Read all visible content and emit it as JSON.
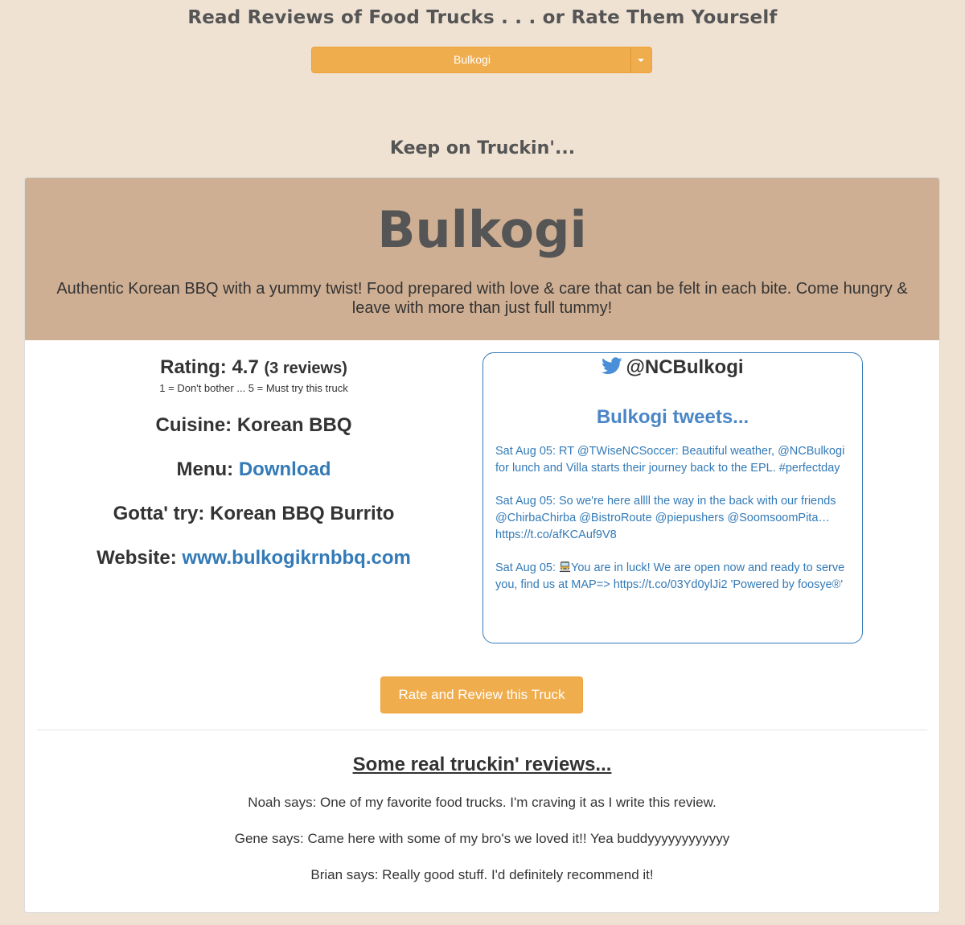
{
  "header": {
    "title": "Read Reviews of Food Trucks . . . or Rate Them Yourself",
    "truck_select": {
      "selected": "Bulkogi"
    },
    "tagline": "Keep on Truckin'..."
  },
  "truck": {
    "name": "Bulkogi",
    "description": "Authentic Korean BBQ with a yummy twist! Food prepared with love & care that can be felt in each bite. Come hungry & leave with more than just full tummy!",
    "rating_label": "Rating: 4.7",
    "rating_count": "(3 reviews)",
    "rating_scale": "1 = Don't bother ... 5 = Must try this truck",
    "cuisine": "Cuisine: Korean BBQ",
    "menu_label": "Menu:",
    "menu_link": "Download",
    "must_try": "Gotta' try: Korean BBQ Burrito",
    "website_label": "Website:",
    "website_link": "www.bulkogikrnbbq.com"
  },
  "twitter": {
    "handle": "@NCBulkogi",
    "tweets_title": "Bulkogi tweets...",
    "tweets": [
      "Sat Aug 05: RT @TWiseNCSoccer: Beautiful weather, @NCBulkogi for lunch and Villa starts their journey back to the EPL. #perfectday",
      "Sat Aug 05: So we're here allll the way in the back with our friends @ChirbaChirba @BistroRoute @piepushers @SoomsoomPita… https://t.co/afKCAuf9V8"
    ],
    "tweet3_prefix": "Sat Aug 05:",
    "tweet3_icon": "train-emoji",
    "tweet3_text": "You are in luck! We are open now and ready to serve you, find us at MAP=> https://t.co/03Yd0ylJi2 'Powered by foosye®'"
  },
  "actions": {
    "rate_button": "Rate and Review this Truck"
  },
  "reviews": {
    "heading": "Some real truckin' reviews...",
    "items": [
      "Noah says: One of my favorite food trucks. I'm craving it as I write this review.",
      "Gene says: Came here with some of my bro's we loved it!! Yea buddyyyyyyyyyyyy",
      "Brian says: Really good stuff. I'd definitely recommend it!"
    ]
  },
  "colors": {
    "page_background": "#EFE2D3",
    "hero_background": "#CFAF93",
    "accent_orange": "#F0AD4E",
    "link_blue": "#337AB7",
    "heading_gray": "#555555"
  }
}
